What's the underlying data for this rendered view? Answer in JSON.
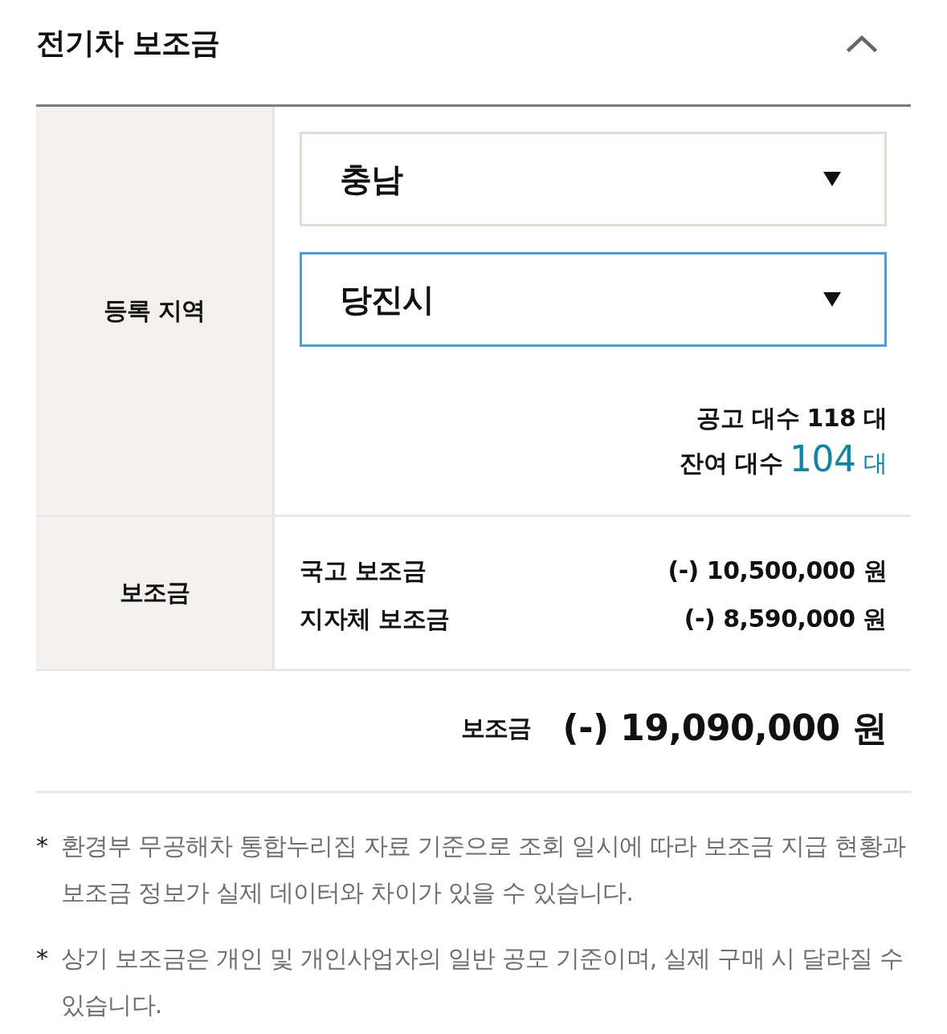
{
  "section": {
    "title": "전기차 보조금",
    "expanded": true
  },
  "region": {
    "label": "등록 지역",
    "selects": [
      {
        "value": "충남",
        "focused": false
      },
      {
        "value": "당진시",
        "focused": true
      }
    ],
    "counts": [
      {
        "kind": "plain",
        "label": "공고 대수",
        "count": "118",
        "unit": "대"
      },
      {
        "kind": "highlight",
        "label": "잔여 대수",
        "count": "104",
        "unit": "대"
      }
    ]
  },
  "subsidy": {
    "label": "보조금",
    "items": [
      {
        "name": "국고 보조금",
        "amount": "(-) 10,500,000 원"
      },
      {
        "name": "지자체 보조금",
        "amount": "(-) 8,590,000 원"
      }
    ]
  },
  "total": {
    "label": "보조금",
    "amount": "(-) 19,090,000 원"
  },
  "notes": [
    {
      "mark": "*",
      "text": "환경부 무공해차 통합누리집 자료 기준으로 조회 일시에 따라 보조금 지급 현황과 보조금 정보가 실제 데이터와 차이가 있을 수 있습니다."
    },
    {
      "mark": "*",
      "text": "상기 보조금은 개인 및 개인사업자의 일반 공모 기준이며, 실제 구매 시 달라질 수 있습니다."
    }
  ]
}
